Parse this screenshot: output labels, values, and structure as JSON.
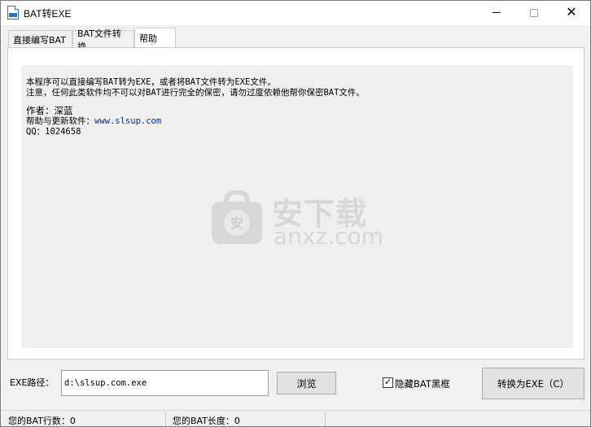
{
  "window": {
    "title": "BAT转EXE",
    "icon": "bat-file-icon",
    "controls": {
      "minimize": "minimize-icon",
      "maximize": "maximize-icon",
      "close": "✕"
    }
  },
  "tabs": [
    {
      "label": "直接编写BAT",
      "active": false
    },
    {
      "label": "BAT文件转换",
      "active": false
    },
    {
      "label": "帮助",
      "active": true
    }
  ],
  "help": {
    "line1": "本程序可以直接编写BAT转为EXE，或者将BAT文件转为EXE文件。",
    "line2": "注意，任何此类软件均不可以对BAT进行完全的保密，请勿过度依赖他帮你保密BAT文件。",
    "author": "作者：深蓝",
    "update_prefix": "帮助与更新软件：",
    "update_link": "www.slsup.com",
    "qq": "QQ：1024658"
  },
  "watermark": {
    "cn": "安下载",
    "en": "anxz.com"
  },
  "form": {
    "exe_label": "EXE路径：",
    "exe_value": "d:\\slsup.com.exe",
    "browse_label": "浏览",
    "hide_label": "隐藏BAT黑框",
    "hide_checked": true,
    "convert_label": "转换为EXE（C）"
  },
  "status": {
    "lines_label": "您的BAT行数：0",
    "length_label": "您的BAT长度：0"
  }
}
